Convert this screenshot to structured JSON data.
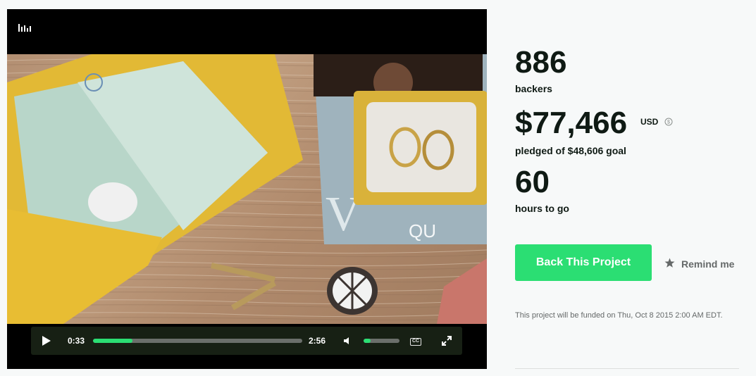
{
  "video": {
    "current_time": "0:33",
    "total_time": "2:56",
    "progress_fraction": 0.19,
    "volume_fraction": 0.2,
    "cc_label": "CC",
    "icons": [
      "equalizer-icon",
      "play-icon",
      "volume-icon",
      "closed-captions-icon",
      "fullscreen-icon"
    ]
  },
  "stats": {
    "backers_count": "886",
    "backers_label": "backers",
    "pledged_amount": "$77,466",
    "currency": "USD",
    "pledged_label": "pledged of $48,606 goal",
    "hours_count": "60",
    "hours_label": "hours to go"
  },
  "actions": {
    "back_button_label": "Back This Project",
    "remind_label": "Remind me"
  },
  "funded_note": "This project will be funded on Thu, Oct 8 2015 2:00 AM EDT.",
  "colors": {
    "accent_green": "#2bde73",
    "text_dark": "#0f1a14",
    "text_muted": "#656969",
    "control_bar_bg": "#172014"
  }
}
